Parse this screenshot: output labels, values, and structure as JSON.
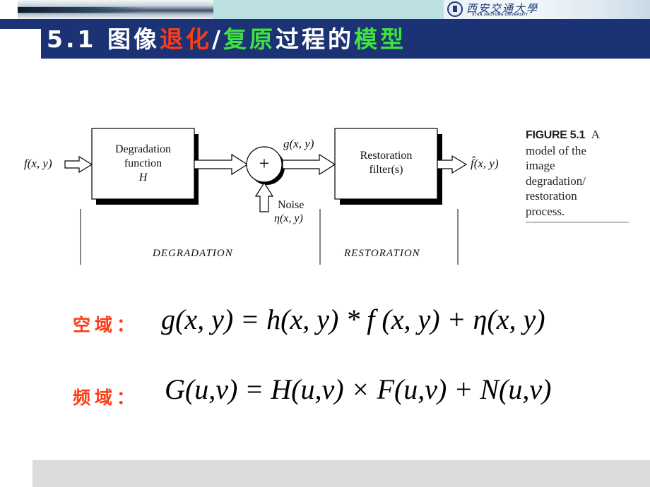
{
  "header": {
    "university_cn": "西安交通大學",
    "university_en": "XI'AN JIAOTONG UNIVERSITY"
  },
  "title": {
    "prefix": "5.1 图像",
    "degradation": "退化",
    "slash": "/",
    "restoration": "复原",
    "middle": "过程的",
    "model": "模型",
    "colors": {
      "text": "#ffffff",
      "degradation": "#ff3b16",
      "model": "#3fe23f",
      "bar": "#1b3375"
    }
  },
  "figure": {
    "input_label": "f(x, y)",
    "degradation_box": [
      "Degradation",
      "function",
      "H"
    ],
    "adder_symbol": "+",
    "g_label": "g(x, y)",
    "noise_label": "Noise",
    "noise_symbol": "η(x, y)",
    "restoration_box": [
      "Restoration",
      "filter(s)"
    ],
    "output_label": "f̂(x, y)",
    "section_degradation": "DEGRADATION",
    "section_restoration": "RESTORATION",
    "caption": {
      "number": "FIGURE 5.1",
      "lines": [
        "A",
        "model of the",
        "image",
        "degradation/",
        "restoration",
        "process."
      ]
    }
  },
  "equations": {
    "spatial": {
      "label": "空域：",
      "formula": "g(x, y) = h(x, y) * f (x, y) + η(x, y)"
    },
    "frequency": {
      "label": "频域：",
      "formula": "G(u,v) = H(u,v) × F(u,v) + N(u,v)"
    }
  }
}
